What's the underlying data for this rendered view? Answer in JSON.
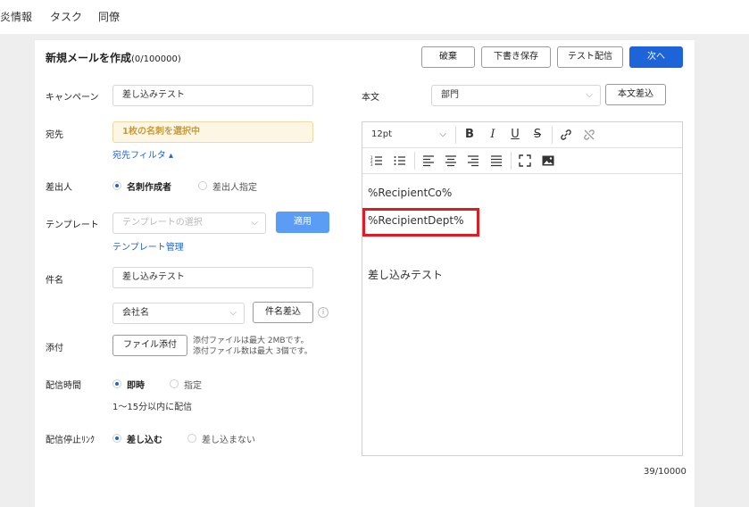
{
  "nav": {
    "items": [
      "炎情報",
      "タスク",
      "同僚"
    ]
  },
  "card": {
    "title": "新規メールを作成",
    "count": "(0/100000)"
  },
  "actions": {
    "discard": "破棄",
    "save_draft": "下書き保存",
    "test_send": "テスト配信",
    "next": "次へ"
  },
  "form": {
    "campaign": {
      "label": "キャンペーン",
      "value": "差し込みテスト"
    },
    "recipient": {
      "label": "宛先",
      "value": "1枚の名刺を選択中",
      "filter_link": "宛先フィルタ ▴"
    },
    "sender": {
      "label": "差出人",
      "option1": "名刺作成者",
      "option2": "差出人指定"
    },
    "template": {
      "label": "テンプレート",
      "placeholder": "テンプレートの選択",
      "apply": "適用",
      "manage_link": "テンプレート管理"
    },
    "subject": {
      "label": "件名",
      "value": "差し込みテスト",
      "insert_field": "会社名",
      "insert_button": "件名差込",
      "info_icon": "info-icon"
    },
    "attachment": {
      "label": "添付",
      "button": "ファイル添付",
      "note1": "添付ファイルは最大 2MBです。",
      "note2": "添付ファイル数は最大 3個です。"
    },
    "delivery": {
      "label": "配信時間",
      "option1": "即時",
      "option2": "指定",
      "note": "1〜15分以内に配信"
    },
    "stop_link": {
      "label": "配信停止ﾘﾝｸ",
      "option1": "差し込む",
      "option2": "差し込まない"
    }
  },
  "body": {
    "label": "本文",
    "field_select": "部門",
    "insert_button": "本文差込",
    "font_size": "12pt",
    "lines": [
      "%RecipientCo%",
      "%RecipientDept%",
      "差し込みテスト"
    ],
    "counter": "39/10000"
  },
  "colors": {
    "primary": "#1d64d8",
    "highlight": "#e01b24",
    "warn_bg": "#fdf6e4"
  }
}
